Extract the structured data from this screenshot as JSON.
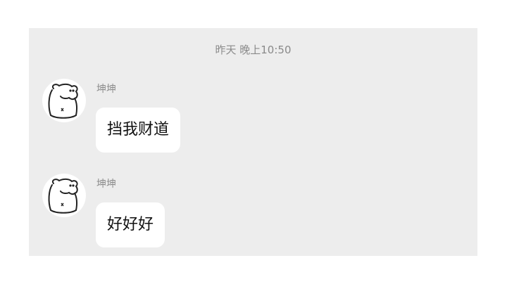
{
  "chat": {
    "timestamp": "昨天 晚上10:50",
    "messages": [
      {
        "sender": "坤坤",
        "text": "挡我财道",
        "avatar_icon": "cartoon-sheep-avatar-icon"
      },
      {
        "sender": "坤坤",
        "text": "好好好",
        "avatar_icon": "cartoon-sheep-avatar-icon"
      }
    ]
  },
  "colors": {
    "panel_bg": "#ededed",
    "bubble_bg": "#ffffff",
    "timestamp_text": "#8a8a8a",
    "sender_text": "#8c8c8c",
    "message_text": "#111111"
  }
}
